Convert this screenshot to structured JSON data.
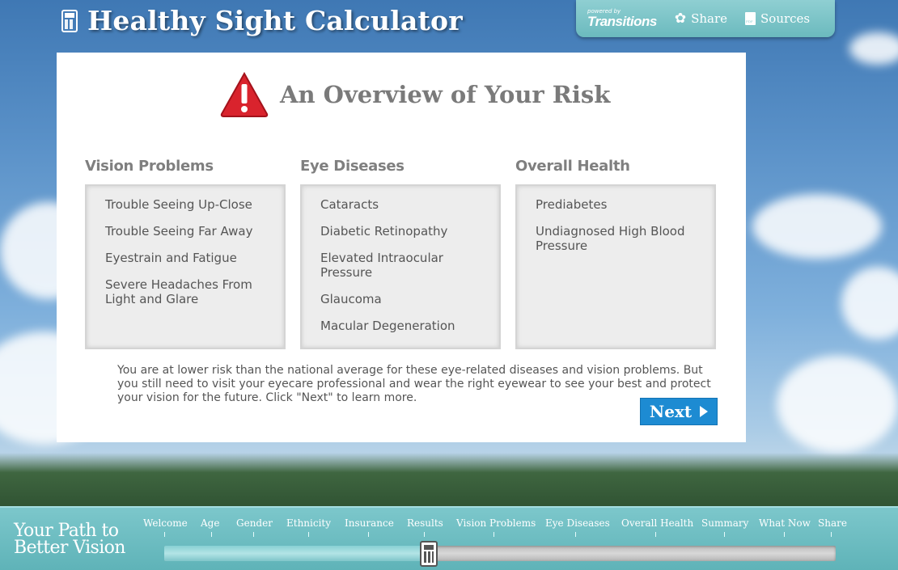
{
  "header": {
    "app_title": "Healthy Sight Calculator",
    "brand_small": "powered by",
    "brand_name": "Transitions",
    "share_label": "Share",
    "sources_label": "Sources",
    "icons": [
      "calculator-icon",
      "flower-share-icon",
      "pdf-document-icon"
    ]
  },
  "panel": {
    "heading": "An Overview of Your Risk",
    "warning_icon_color": "#d9232d",
    "columns": [
      {
        "title": "Vision Problems",
        "items": [
          "Trouble Seeing Up-Close",
          "Trouble Seeing Far Away",
          "Eyestrain and Fatigue",
          "Severe Headaches From Light and Glare"
        ]
      },
      {
        "title": "Eye Diseases",
        "items": [
          "Cataracts",
          "Diabetic Retinopathy",
          "Elevated Intraocular Pressure",
          "Glaucoma",
          "Macular Degeneration"
        ]
      },
      {
        "title": "Overall Health",
        "items": [
          "Prediabetes",
          "Undiagnosed High Blood Pressure"
        ]
      }
    ],
    "summary": "You are at lower risk than the national average for these eye-related diseases and vision problems. But you still need to visit your eyecare professional and wear the right eyewear to see your best and protect your vision for the future. Click \"Next\" to learn more.",
    "next_label": "Next",
    "accent_color": "#1d8bd2"
  },
  "footer": {
    "path_title_line1": "Your Path to",
    "path_title_line2": "Better Vision",
    "steps": [
      "Welcome",
      "Age",
      "Gender",
      "Ethnicity",
      "Insurance",
      "Results",
      "Vision Problems",
      "Eye Diseases",
      "Overall Health",
      "Summary",
      "What Now",
      "Share"
    ],
    "current_step": "Vision Problems",
    "progress": 0.39,
    "color": "#6bbabe"
  }
}
